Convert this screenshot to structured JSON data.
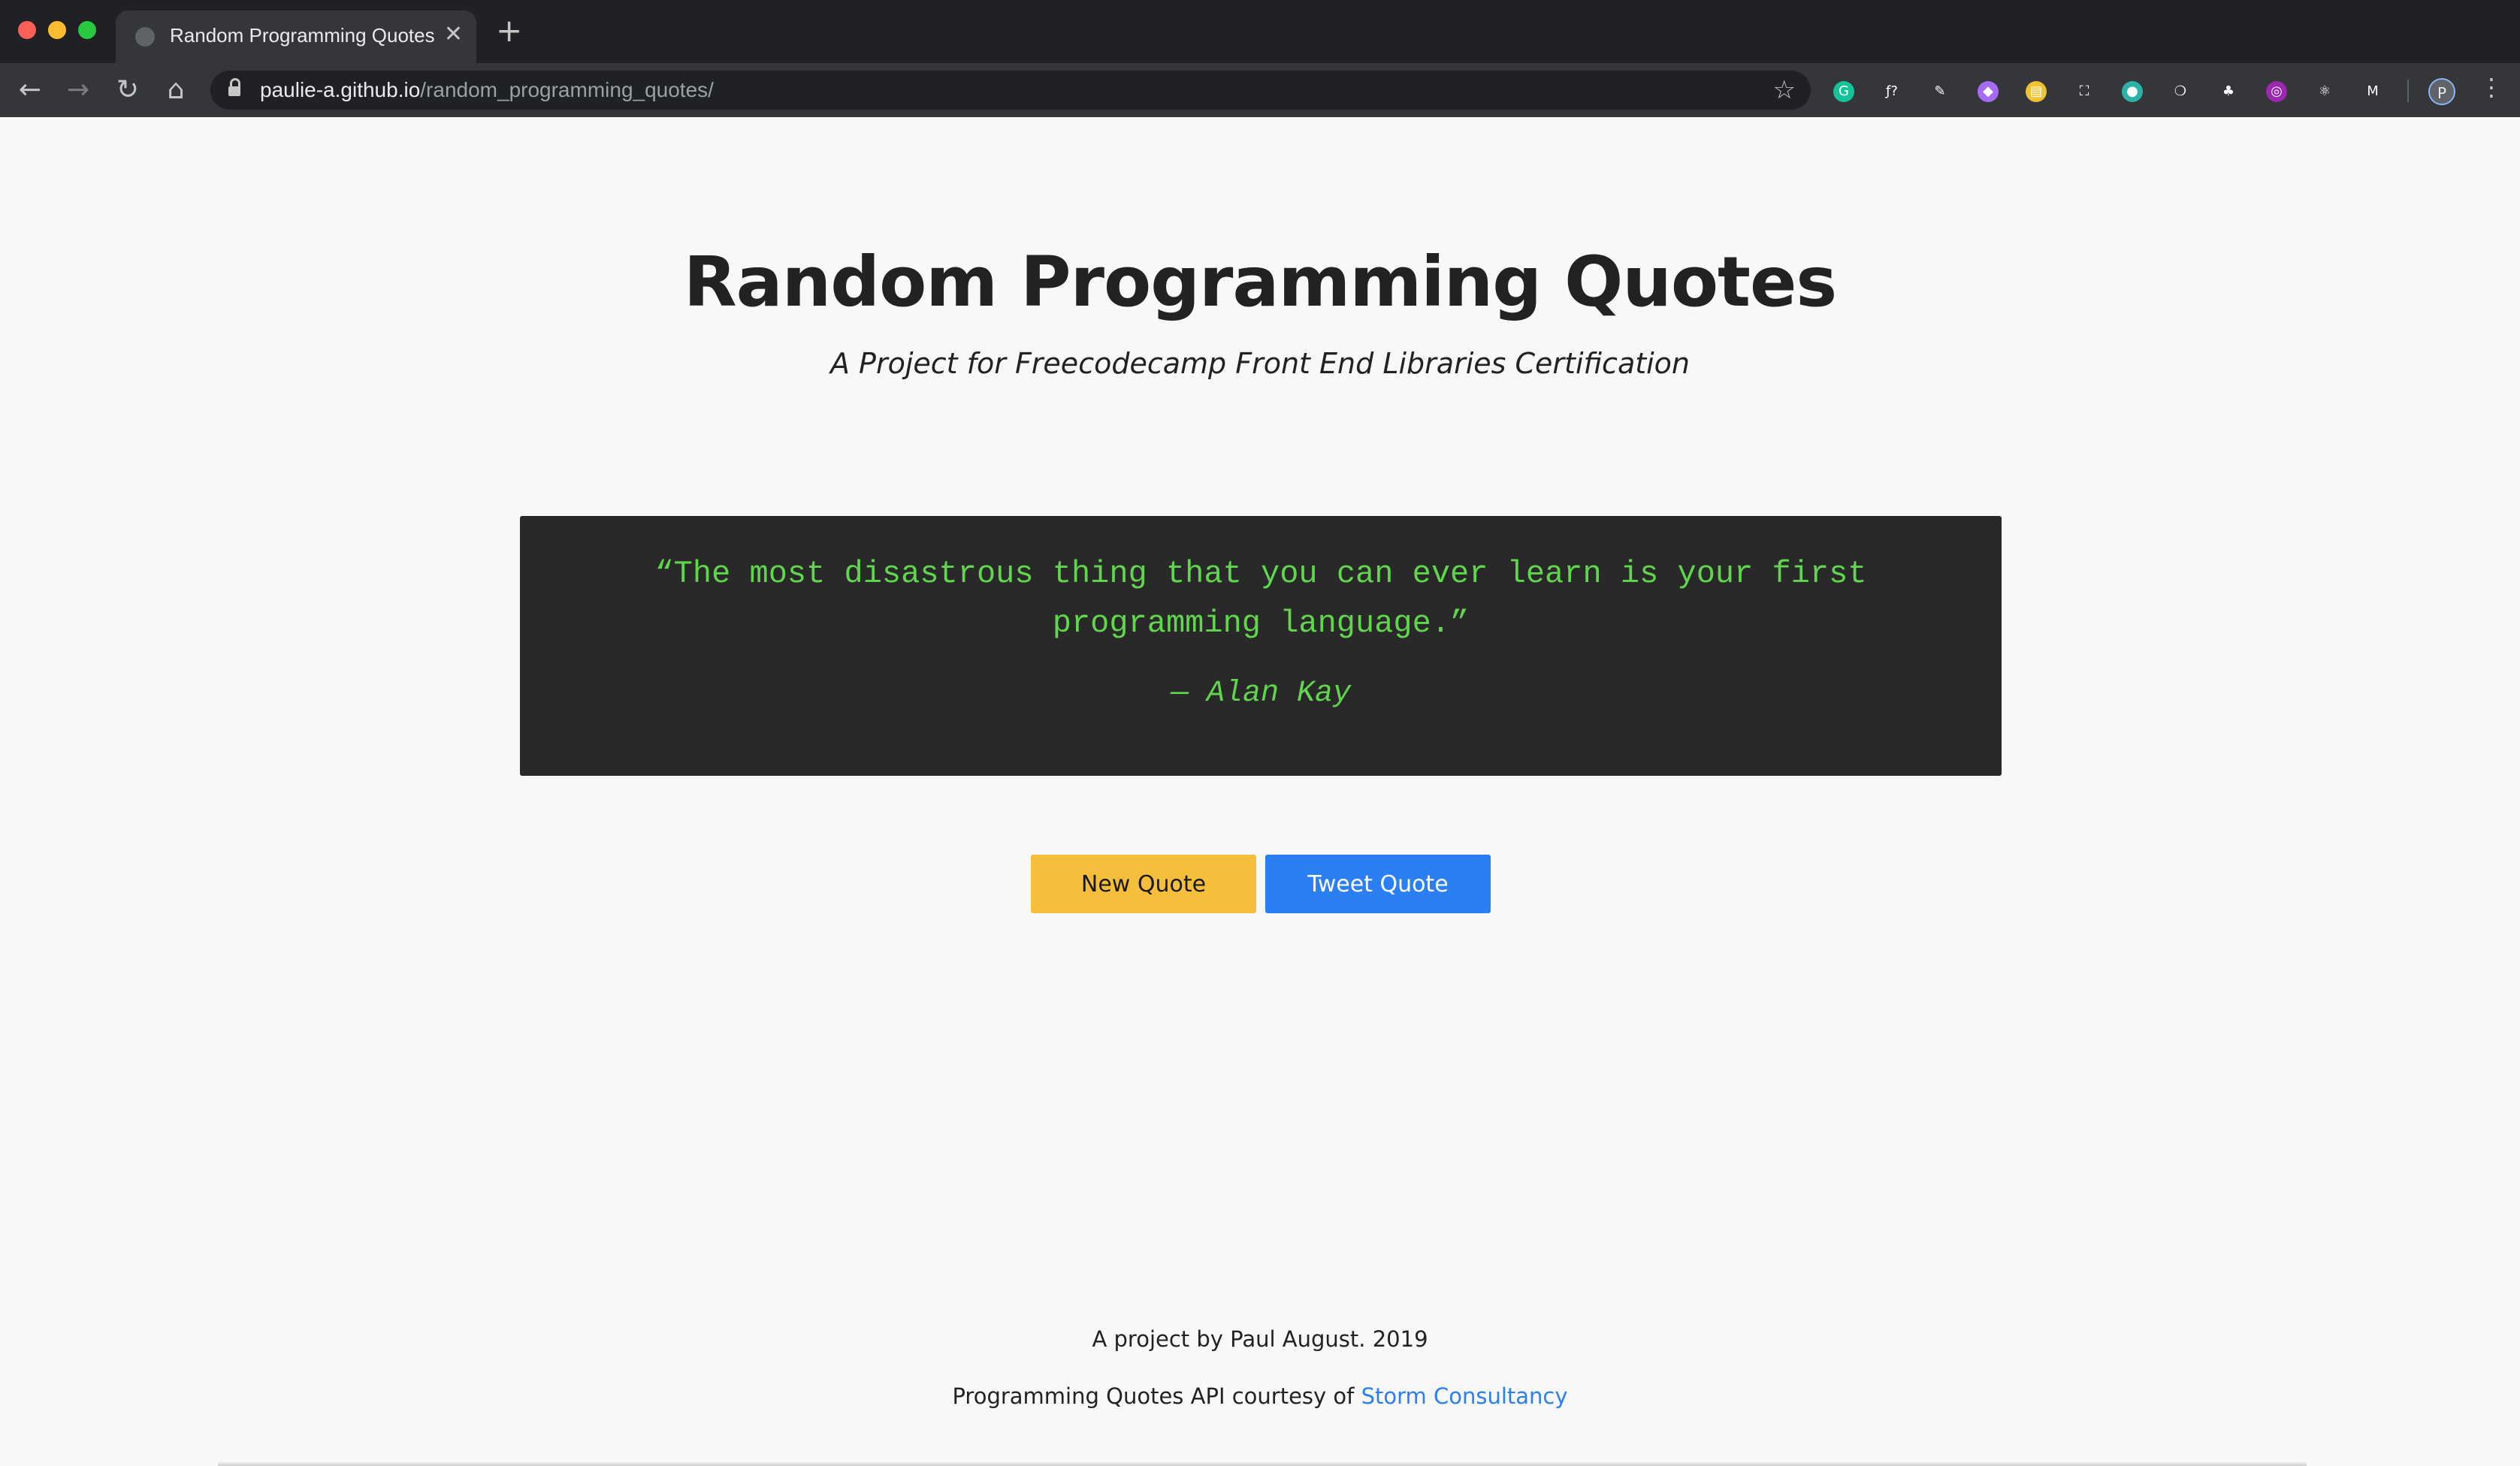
{
  "browser": {
    "tab_title": "Random Programming Quotes",
    "tab_close": "✕",
    "new_tab": "+",
    "url_host": "paulie-a.github.io",
    "url_path": "/random_programming_quotes/",
    "profile_initial": "P",
    "nav": {
      "back": "←",
      "forward": "→",
      "reload": "↻",
      "home": "⌂"
    },
    "star": "☆",
    "menu": "⋮",
    "extensions": [
      {
        "name": "grammarly-extension-icon",
        "color": "#15c39a",
        "glyph": "G"
      },
      {
        "name": "formula-extension-icon",
        "color": "#35363a",
        "glyph": "ƒ?"
      },
      {
        "name": "pen-extension-icon",
        "color": "#35363a",
        "glyph": "✎"
      },
      {
        "name": "tag-extension-icon",
        "color": "#a66bf5",
        "glyph": "◆"
      },
      {
        "name": "notes-extension-icon",
        "color": "#f2c12e",
        "glyph": "▤"
      },
      {
        "name": "screenshot-extension-icon",
        "color": "#35363a",
        "glyph": "⛶"
      },
      {
        "name": "circle-extension-icon",
        "color": "#2bb3a8",
        "glyph": "●"
      },
      {
        "name": "bulb-extension-icon",
        "color": "#35363a",
        "glyph": "❍"
      },
      {
        "name": "tree-extension-icon",
        "color": "#35363a",
        "glyph": "♣"
      },
      {
        "name": "purple-extension-icon",
        "color": "#9c27b0",
        "glyph": "◎"
      },
      {
        "name": "react-extension-icon",
        "color": "#35363a",
        "glyph": "⚛"
      },
      {
        "name": "m-extension-icon",
        "color": "#35363a",
        "glyph": "M"
      }
    ]
  },
  "header": {
    "title": "Random Programming Quotes",
    "subtitle": "A Project for Freecodecamp Front End Libraries Certification"
  },
  "quote": {
    "text": "“The most disastrous thing that you can ever learn is your first programming language.”",
    "author": "— Alan Kay"
  },
  "buttons": {
    "new_quote": "New Quote",
    "tweet_quote": "Tweet Quote"
  },
  "footer": {
    "credit": "A project by Paul August. 2019",
    "api_prefix": "Programming Quotes API courtesy of ",
    "api_link": "Storm Consultancy"
  },
  "colors": {
    "quote_bg": "#292929",
    "quote_text": "#5fd64c",
    "new_quote_button": "#f5bf3b",
    "tweet_button": "#2a7ff4",
    "page_bg": "#f8f8f8"
  }
}
